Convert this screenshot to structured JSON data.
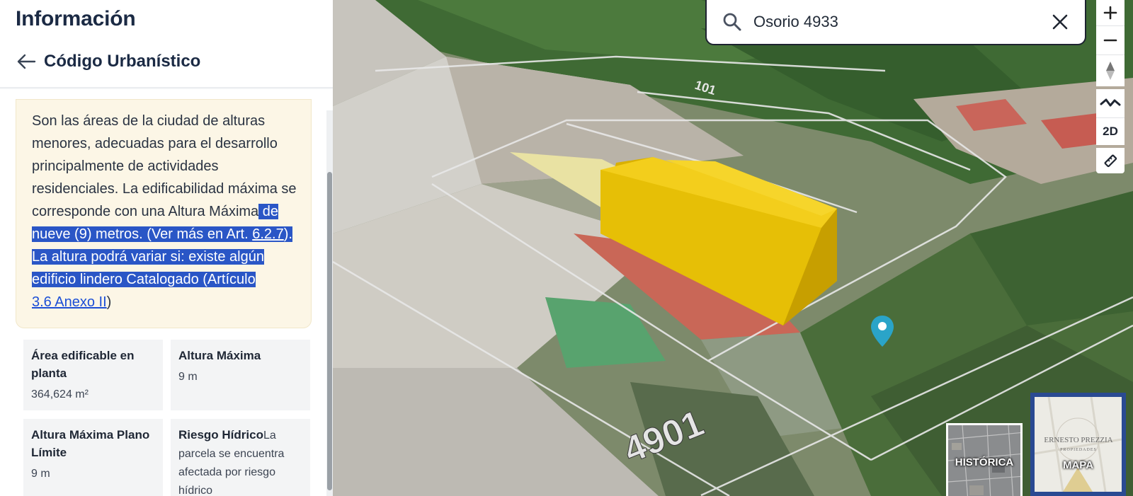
{
  "panel": {
    "title": "Información",
    "section_title": "Código Urbanístico",
    "description": {
      "plain": "Son las áreas de la ciudad de alturas menores, adecuadas para el desarrollo principalmente de actividades residenciales. La edificabilidad máxima se corresponde con una Altura Máxima",
      "highlight_1": " de nueve (9) metros. (Ver más en Art. ",
      "link_1": "6.2.7",
      "highlight_2": "). La altura podrá variar si: existe algún edificio lindero Catalogado (Artículo",
      "link_2": "3.6 Anexo II",
      "tail": ")"
    },
    "stats": [
      {
        "label": "Área edificable en planta",
        "value": "364,624 m²"
      },
      {
        "label": "Altura Máxima",
        "value": "9 m"
      },
      {
        "label": "Altura Máxima Plano Límite",
        "value": "9 m"
      },
      {
        "label": "Riesgo Hídrico",
        "value": "La parcela se encuentra afectada por riesgo hídrico"
      }
    ]
  },
  "search": {
    "value": "Osorio 4933",
    "icon": "search-icon",
    "clear_icon": "close-icon"
  },
  "map_controls": {
    "zoom_in": "+",
    "zoom_out": "−",
    "mode_2d": "2D"
  },
  "map_labels": {
    "street_number_large": "4901",
    "street_number_small": "101"
  },
  "basemaps": {
    "historic_label": "HISTÓRICA",
    "map_label": "MAPA",
    "watermark": "ERNESTO PREZZIA",
    "watermark_sub": "PROPIEDADES"
  },
  "colors": {
    "accent": "#2a56c6",
    "building_volume": "#f2c600",
    "marker": "#2aa4c8",
    "highlight_box": "#fcf6e6"
  }
}
